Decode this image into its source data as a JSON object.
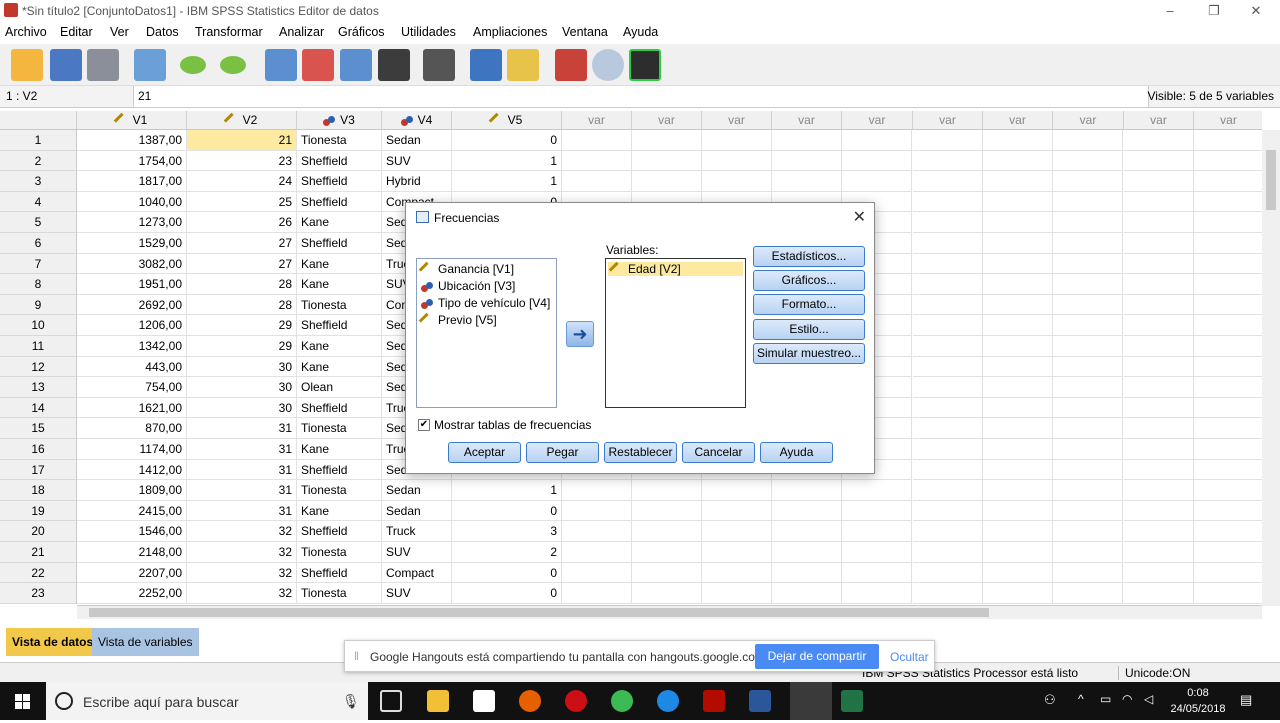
{
  "window": {
    "title": "*Sin título2 [ConjuntoDatos1] - IBM SPSS Statistics Editor de datos"
  },
  "menu": [
    "Archivo",
    "Editar",
    "Ver",
    "Datos",
    "Transformar",
    "Analizar",
    "Gráficos",
    "Utilidades",
    "Ampliaciones",
    "Ventana",
    "Ayuda"
  ],
  "cellbar": {
    "ref": "1 : V2",
    "value": "21",
    "visible": "Visible: 5 de 5 variables"
  },
  "columns": [
    "V1",
    "V2",
    "V3",
    "V4",
    "V5",
    "var",
    "var",
    "var",
    "var",
    "var",
    "var",
    "var",
    "var",
    "var",
    "var"
  ],
  "rows": [
    [
      "1",
      "1387,00",
      "21",
      "Tionesta",
      "Sedan",
      "0"
    ],
    [
      "2",
      "1754,00",
      "23",
      "Sheffield",
      "SUV",
      "1"
    ],
    [
      "3",
      "1817,00",
      "24",
      "Sheffield",
      "Hybrid",
      "1"
    ],
    [
      "4",
      "1040,00",
      "25",
      "Sheffield",
      "Compact",
      "0"
    ],
    [
      "5",
      "1273,00",
      "26",
      "Kane",
      "Sedan",
      ""
    ],
    [
      "6",
      "1529,00",
      "27",
      "Sheffield",
      "Sedan",
      ""
    ],
    [
      "7",
      "3082,00",
      "27",
      "Kane",
      "Truck",
      ""
    ],
    [
      "8",
      "1951,00",
      "28",
      "Kane",
      "SUV",
      ""
    ],
    [
      "9",
      "2692,00",
      "28",
      "Tionesta",
      "Compact",
      ""
    ],
    [
      "10",
      "1206,00",
      "29",
      "Sheffield",
      "Sedan",
      ""
    ],
    [
      "11",
      "1342,00",
      "29",
      "Kane",
      "Sedan",
      ""
    ],
    [
      "12",
      "443,00",
      "30",
      "Kane",
      "Sedan",
      ""
    ],
    [
      "13",
      "754,00",
      "30",
      "Olean",
      "Sedan",
      ""
    ],
    [
      "14",
      "1621,00",
      "30",
      "Sheffield",
      "Truck",
      ""
    ],
    [
      "15",
      "870,00",
      "31",
      "Tionesta",
      "Sedan",
      ""
    ],
    [
      "16",
      "1174,00",
      "31",
      "Kane",
      "Truck",
      ""
    ],
    [
      "17",
      "1412,00",
      "31",
      "Sheffield",
      "Sedan",
      ""
    ],
    [
      "18",
      "1809,00",
      "31",
      "Tionesta",
      "Sedan",
      "1"
    ],
    [
      "19",
      "2415,00",
      "31",
      "Kane",
      "Sedan",
      "0"
    ],
    [
      "20",
      "1546,00",
      "32",
      "Sheffield",
      "Truck",
      "3"
    ],
    [
      "21",
      "2148,00",
      "32",
      "Tionesta",
      "SUV",
      "2"
    ],
    [
      "22",
      "2207,00",
      "32",
      "Sheffield",
      "Compact",
      "0"
    ],
    [
      "23",
      "2252,00",
      "32",
      "Tionesta",
      "SUV",
      "0"
    ]
  ],
  "tabs": {
    "data_view": "Vista de datos",
    "variable_view": "Vista de variables"
  },
  "status": {
    "processor": "IBM SPSS Statistics Processor está listo",
    "unicode": "Unicode:ON"
  },
  "hangouts": {
    "message": "Google Hangouts está compartiendo tu pantalla con hangouts.google.com.",
    "stop_label": "Dejar de compartir",
    "hide_label": "Ocultar"
  },
  "dialog": {
    "title": "Frecuencias",
    "source_vars": [
      "Ganancia [V1]",
      "Ubicación [V3]",
      "Tipo de vehículo [V4]",
      "Previo [V5]"
    ],
    "variables_label": "Variables:",
    "target_vars": [
      "Edad [V2]"
    ],
    "side_buttons": [
      "Estadísticos...",
      "Gráficos...",
      "Formato...",
      "Estilo...",
      "Simular muestreo..."
    ],
    "checkbox_label": "Mostrar tablas de frecuencias",
    "checkbox_checked": true,
    "bottom_buttons": [
      "Aceptar",
      "Pegar",
      "Restablecer",
      "Cancelar",
      "Ayuda"
    ]
  },
  "taskbar": {
    "search_placeholder": "Escribe aquí para buscar",
    "time": "0:08",
    "date": "24/05/2018"
  }
}
